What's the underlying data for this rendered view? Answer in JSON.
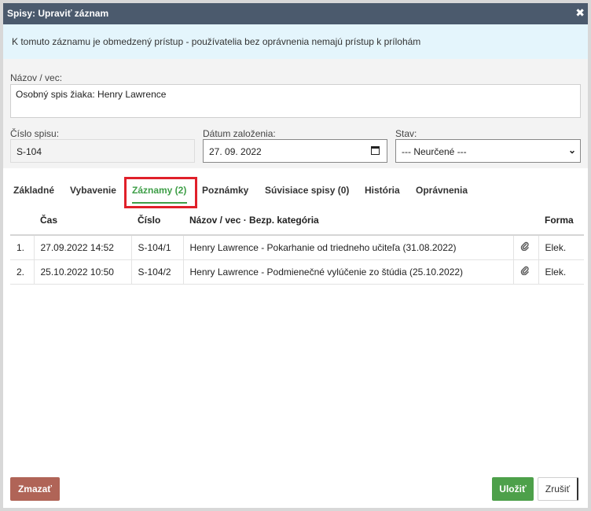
{
  "dialog": {
    "title": "Spisy: Upraviť záznam",
    "close_symbol": "✖"
  },
  "notice": "K tomuto záznamu je obmedzený prístup - používatelia bez oprávnenia nemajú prístup k prílohám",
  "form": {
    "name_label": "Názov / vec:",
    "name_value": "Osobný spis žiaka: Henry Lawrence",
    "number_label": "Číslo spisu:",
    "number_value": "S-104",
    "date_label": "Dátum založenia:",
    "date_value": "27. 09. 2022",
    "status_label": "Stav:",
    "status_value": "--- Neurčené ---"
  },
  "tabs": [
    {
      "label": "Základné"
    },
    {
      "label": "Vybavenie"
    },
    {
      "label": "Záznamy (2)"
    },
    {
      "label": "Poznámky"
    },
    {
      "label": "Súvisiace spisy (0)"
    },
    {
      "label": "História"
    },
    {
      "label": "Oprávnenia"
    }
  ],
  "table": {
    "headers": [
      "",
      "Čas",
      "Číslo",
      "Názov / vec · Bezp. kategória",
      "",
      "Forma"
    ],
    "rows": [
      {
        "idx": "1.",
        "time": "27.09.2022 14:52",
        "number": "S-104/1",
        "title": "Henry Lawrence - Pokarhanie od triedneho učiteľa (31.08.2022)",
        "attachment": "paperclip-icon",
        "form": "Elek."
      },
      {
        "idx": "2.",
        "time": "25.10.2022 10:50",
        "number": "S-104/2",
        "title": "Henry Lawrence - Podmienečné vylúčenie zo štúdia (25.10.2022)",
        "attachment": "paperclip-icon",
        "form": "Elek."
      }
    ]
  },
  "buttons": {
    "delete": "Zmazať",
    "save": "Uložiť",
    "cancel": "Zrušiť"
  },
  "colors": {
    "titlebar": "#4b5a6d",
    "active_tab": "#3e9e47",
    "highlight": "#e0202a",
    "save": "#4da04a",
    "delete": "#b06457"
  }
}
